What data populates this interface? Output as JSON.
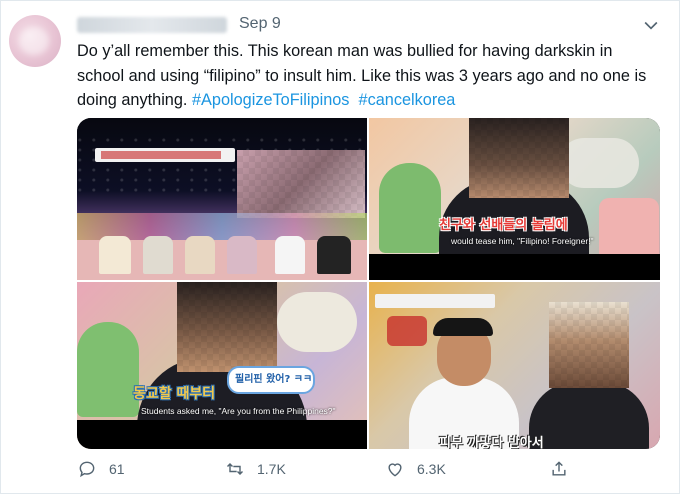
{
  "tweet": {
    "date": "Sep 9",
    "text_main": "Do y’all remember this. This korean man was bullied for having darkskin in school and using “filipino” to insult him. Like this was 3 years ago and no one is doing anything. ",
    "hashtag1": "#ApologizeToFilipinos",
    "hashtag2": "#cancelkorea"
  },
  "media": {
    "panel2_subtitle": "would tease him, \"Filipino! Foreigner!\"",
    "panel2_caption": "친구와 선배들의 놀림에",
    "panel3_subtitle": "Students asked me, \"Are you from the Philippines?\"",
    "panel3_caption": "동교할 때부터",
    "panel3_bubble": "필리핀 왔어? ㅋㅋ",
    "panel4_caption": "피부 까맣다 받아서"
  },
  "actions": {
    "reply_count": "61",
    "retweet_count": "1.7K",
    "like_count": "6.3K",
    "icons": [
      "reply-icon",
      "retweet-icon",
      "like-icon",
      "share-icon"
    ]
  },
  "colors": {
    "hashtag": "#1b95e0",
    "meta": "#536471"
  }
}
